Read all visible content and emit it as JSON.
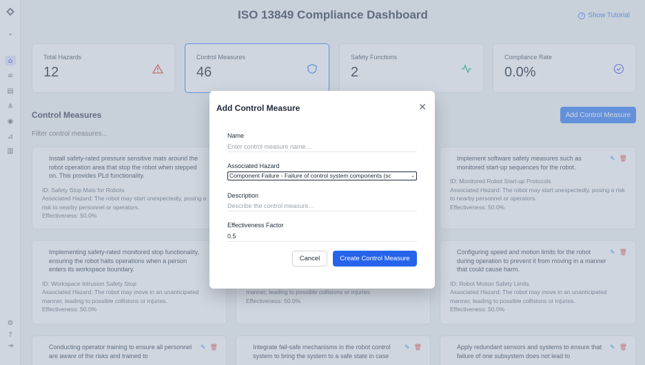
{
  "header": {
    "title": "ISO 13849 Compliance Dashboard",
    "tutorial_label": "Show Tutorial"
  },
  "stats": [
    {
      "label": "Total Hazards",
      "value": "12",
      "icon": "warning-triangle-icon",
      "color": "#ef4444"
    },
    {
      "label": "Control Measures",
      "value": "46",
      "icon": "shield-icon",
      "color": "#3b82f6"
    },
    {
      "label": "Safety Functions",
      "value": "2",
      "icon": "activity-icon",
      "color": "#10b981"
    },
    {
      "label": "Compliance Rate",
      "value": "0.0%",
      "icon": "check-circle-icon",
      "color": "#6366f1"
    }
  ],
  "section": {
    "title": "Control Measures",
    "add_label": "Add Control Measure",
    "filter_placeholder": "Filter control measures..."
  },
  "measures": [
    {
      "desc": "Install safety-rated pressure sensitive mats around the robot operation area that stop the robot when stepped on. This provides PLd functionality.",
      "id": "ID: Safety Stop Mats for Robots",
      "hazard": "Associated Hazard: The robot may start unexpectedly, posing a risk to nearby personnel or operators.",
      "eff": "Effectiveness: 50.0%"
    },
    {
      "desc": "Implement software safety measures such as monitored start-up sequences for the robot.",
      "id": "ID: Monitored Robot Start-up Protocols",
      "hazard": "Associated Hazard: The robot may start unexpectedly, posing a risk to nearby personnel or operators.",
      "eff": "Effectiveness: 50.0%"
    },
    {
      "desc": "Implementing safety-rated monitored stop functionality, ensuring the robot halts operations when a person enters its workspace boundary.",
      "id": "ID: Workspace Intrusion Safety Stop",
      "hazard": "Associated Hazard: The robot may move in an unanticipated manner, leading to possible collisions or injuries.",
      "eff": "Effectiveness: 50.0%"
    },
    {
      "desc": "",
      "id": "",
      "hazard": "manner, leading to possible collisions or injuries.",
      "eff": "Effectiveness: 50.0%"
    },
    {
      "desc": "Configuring speed and motion limits for the robot during operation to prevent it from moving in a manner that could cause harm.",
      "id": "ID: Robot Motion Safety Limits",
      "hazard": "Associated Hazard: The robot may move in an unanticipated manner, leading to possible collisions or injuries.",
      "eff": "Effectiveness: 50.0%"
    },
    {
      "desc": "Conducting operator training to ensure all personnel are aware of the risks and trained to",
      "id": "",
      "hazard": "",
      "eff": ""
    },
    {
      "desc": "Integrate fail-safe mechanisms in the robot control system to bring the system to a safe state in case",
      "id": "",
      "hazard": "",
      "eff": ""
    },
    {
      "desc": "Apply redundant sensors and systems to ensure that failure of one subsystem does not lead to",
      "id": "",
      "hazard": "",
      "eff": ""
    }
  ],
  "modal": {
    "title": "Add Control Measure",
    "name_label": "Name",
    "name_placeholder": "Enter control measure name...",
    "hazard_label": "Associated Hazard",
    "hazard_value": "Component Failure - Failure of control system components (sc",
    "description_label": "Description",
    "description_placeholder": "Describe the control measure...",
    "effectiveness_label": "Effectiveness Factor",
    "effectiveness_value": "0.5",
    "cancel_label": "Cancel",
    "create_label": "Create Control Measure"
  },
  "colors": {
    "accent": "#3b82f6",
    "primary_button": "#2563eb",
    "danger": "#ef4444"
  }
}
